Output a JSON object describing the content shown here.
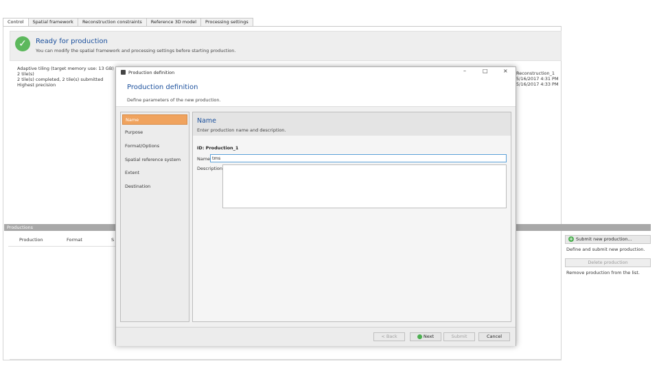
{
  "tabs": [
    "Control",
    "Spatial framework",
    "Reconstruction constraints",
    "Reference 3D model",
    "Processing settings"
  ],
  "banner": {
    "title": "Ready for production",
    "subtitle": "You can modify the spatial framework and processing settings before starting production."
  },
  "info": {
    "line1": "Adaptive tiling (target memory use: 13 GB)",
    "line2": "2 tile(s)",
    "line3": "2 tile(s) completed, 2 tile(s) submitted",
    "line4": "Highest precision"
  },
  "reconstruction": {
    "line1": "Reconstruction_1",
    "line2": "5/16/2017 4:31 PM",
    "line3": "5/16/2017 4:33 PM"
  },
  "productions": {
    "header": "Productions",
    "col_production": "Production",
    "col_format": "Format",
    "col_s": "S"
  },
  "side_actions": {
    "submit_label": "Submit new production...",
    "submit_desc": "Define and submit new production.",
    "delete_label": "Delete production",
    "delete_desc": "Remove production from the list."
  },
  "dialog": {
    "window_title": "Production definition",
    "heading": "Production definition",
    "subheading": "Define parameters of the new production.",
    "nav": [
      "Name",
      "Purpose",
      "Format/Options",
      "Spatial reference system",
      "Extent",
      "Destination"
    ],
    "section_title": "Name",
    "section_sub": "Enter production name and description.",
    "id_line": "ID: Production_1",
    "name_label": "Name",
    "name_value": "tms",
    "description_label": "Description",
    "buttons": {
      "back": "< Back",
      "next": "Next",
      "submit": "Submit",
      "cancel": "Cancel"
    },
    "controls": {
      "minimize": "–",
      "maximize": "□",
      "close": "×"
    }
  },
  "colors": {
    "accent": "#1a4f9c",
    "nav_selected": "#f0a35e",
    "success": "#5cb85c"
  }
}
